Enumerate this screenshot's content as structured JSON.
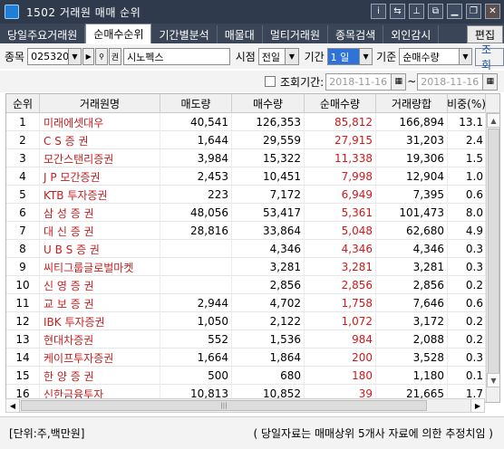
{
  "window": {
    "title": "1502 거래원 매매 순위"
  },
  "titlebar_icons": [
    "info-icon",
    "link-icon",
    "pin-icon",
    "popout-icon",
    "minimize-icon",
    "restore-icon",
    "close-icon"
  ],
  "tabs": [
    {
      "label": "당일주요거래원",
      "active": false
    },
    {
      "label": "순매수순위",
      "active": true
    },
    {
      "label": "기간별분석",
      "active": false
    },
    {
      "label": "매물대",
      "active": false
    },
    {
      "label": "멀티거래원",
      "active": false
    },
    {
      "label": "종목검색",
      "active": false
    },
    {
      "label": "외인감시",
      "active": false
    }
  ],
  "edit_label": "편집",
  "filters": {
    "stock_label": "종목",
    "stock_code": "025320",
    "stock_name": "시노펙스",
    "time_label": "시점",
    "time_value": "전일",
    "period_label": "기간",
    "period_value": "1 일",
    "basis_label": "기준",
    "basis_value": "순매수량",
    "query_label": "조회",
    "period_query_label": "조회기간:",
    "date_from": "2018-11-16",
    "date_to": "2018-11-16",
    "date_sep": "~"
  },
  "table": {
    "columns": [
      "순위",
      "거래원명",
      "매도량",
      "매수량",
      "순매수량",
      "거래량합",
      "비중(%)"
    ],
    "rows": [
      {
        "rank": "1",
        "name": "미래에셋대우",
        "sell": "40,541",
        "buy": "126,353",
        "net": "85,812",
        "total": "166,894",
        "ratio": "13.1"
      },
      {
        "rank": "2",
        "name": "C  S   증 권",
        "sell": "1,644",
        "buy": "29,559",
        "net": "27,915",
        "total": "31,203",
        "ratio": "2.4"
      },
      {
        "rank": "3",
        "name": "모간스탠리증권",
        "sell": "3,984",
        "buy": "15,322",
        "net": "11,338",
        "total": "19,306",
        "ratio": "1.5"
      },
      {
        "rank": "4",
        "name": "J P 모간증권",
        "sell": "2,453",
        "buy": "10,451",
        "net": "7,998",
        "total": "12,904",
        "ratio": "1.0"
      },
      {
        "rank": "5",
        "name": "KTB 투자증권",
        "sell": "223",
        "buy": "7,172",
        "net": "6,949",
        "total": "7,395",
        "ratio": "0.6"
      },
      {
        "rank": "6",
        "name": "삼 성  증 권",
        "sell": "48,056",
        "buy": "53,417",
        "net": "5,361",
        "total": "101,473",
        "ratio": "8.0"
      },
      {
        "rank": "7",
        "name": "대 신  증 권",
        "sell": "28,816",
        "buy": "33,864",
        "net": "5,048",
        "total": "62,680",
        "ratio": "4.9"
      },
      {
        "rank": "8",
        "name": "U B S  증 권",
        "sell": "",
        "buy": "4,346",
        "net": "4,346",
        "total": "4,346",
        "ratio": "0.3"
      },
      {
        "rank": "9",
        "name": "씨티그룹글로벌마켓",
        "sell": "",
        "buy": "3,281",
        "net": "3,281",
        "total": "3,281",
        "ratio": "0.3"
      },
      {
        "rank": "10",
        "name": "신 영  증 권",
        "sell": "",
        "buy": "2,856",
        "net": "2,856",
        "total": "2,856",
        "ratio": "0.2"
      },
      {
        "rank": "11",
        "name": "교 보  증 권",
        "sell": "2,944",
        "buy": "4,702",
        "net": "1,758",
        "total": "7,646",
        "ratio": "0.6"
      },
      {
        "rank": "12",
        "name": "IBK 투자증권",
        "sell": "1,050",
        "buy": "2,122",
        "net": "1,072",
        "total": "3,172",
        "ratio": "0.2"
      },
      {
        "rank": "13",
        "name": "현대차증권",
        "sell": "552",
        "buy": "1,536",
        "net": "984",
        "total": "2,088",
        "ratio": "0.2"
      },
      {
        "rank": "14",
        "name": "케이프투자증권",
        "sell": "1,664",
        "buy": "1,864",
        "net": "200",
        "total": "3,528",
        "ratio": "0.3"
      },
      {
        "rank": "15",
        "name": "한 양  증 권",
        "sell": "500",
        "buy": "680",
        "net": "180",
        "total": "1,180",
        "ratio": "0.1"
      },
      {
        "rank": "16",
        "name": "신한금융투자",
        "sell": "10,813",
        "buy": "10,852",
        "net": "39",
        "total": "21,665",
        "ratio": "1.7"
      }
    ]
  },
  "status": {
    "unit": "[단위:주,백만원]",
    "note": "( 당일자료는 매매상위 5개사 자료에 의한 추정치임 )"
  },
  "colors": {
    "titlebar": "#2f3a4c",
    "broker_name": "#c41e1e",
    "net_buy": "#d21818",
    "period_highlight": "#2f73d9"
  }
}
